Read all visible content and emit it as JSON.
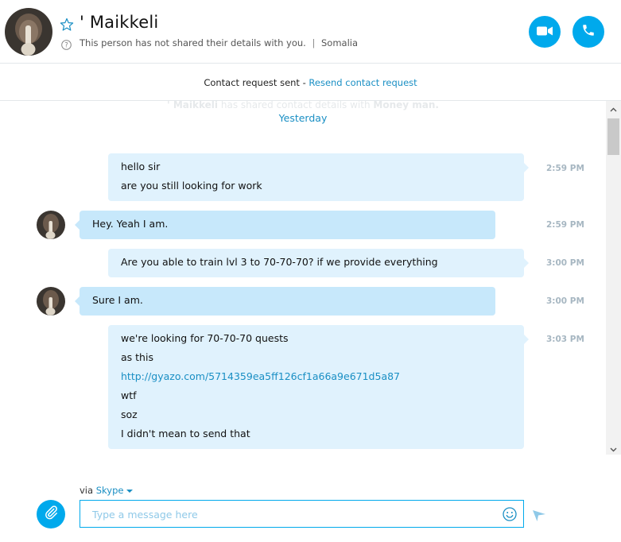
{
  "header": {
    "contact_name": "' Maikkeli",
    "details_text": "This person has not shared their details with you.",
    "separator": "|",
    "location": "Somalia"
  },
  "request_bar": {
    "status_text": "Contact request sent -",
    "resend_link": "Resend contact request"
  },
  "conversation": {
    "faded_event": {
      "name_1": "' Maikkeli",
      "middle": "has shared contact details with",
      "name_2": "Money man."
    },
    "day_divider": "Yesterday",
    "messages": [
      {
        "direction": "out",
        "lines": [
          "hello sir",
          "are you still looking for work"
        ],
        "time": "2:59 PM"
      },
      {
        "direction": "in",
        "lines": [
          "Hey. Yeah I am."
        ],
        "time": "2:59 PM"
      },
      {
        "direction": "out",
        "lines": [
          "Are you able to train lvl 3 to 70-70-70? if we provide everything"
        ],
        "time": "3:00 PM"
      },
      {
        "direction": "in",
        "lines": [
          "Sure I am."
        ],
        "time": "3:00 PM"
      },
      {
        "direction": "out",
        "lines": [
          "we're looking for 70-70-70 quests",
          "as this",
          "http://gyazo.com/5714359ea5ff126cf1a66a9e671d5a87",
          "wtf",
          "soz",
          "I didn't mean to send that"
        ],
        "time": "3:03 PM"
      }
    ]
  },
  "compose": {
    "via_label": "via",
    "service": "Skype",
    "placeholder": "Type a message here"
  },
  "icons": {
    "star": "star-outline-icon",
    "info": "question-circle-icon",
    "video": "video-camera-icon",
    "phone": "phone-icon",
    "attach": "paperclip-icon",
    "emoji": "smiley-icon",
    "send": "send-arrow-icon"
  },
  "colors": {
    "accent": "#00a9ec",
    "link": "#1a8fc4",
    "bubble_out": "#e0f2fd",
    "bubble_in": "#c7e8fb",
    "timestamp": "#a7b7c2"
  }
}
